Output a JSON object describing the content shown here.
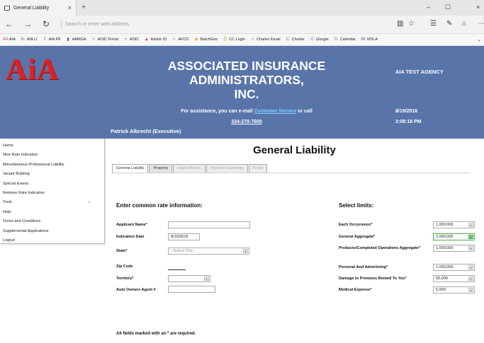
{
  "browser": {
    "tab_title": "General Liability",
    "tab_close": "×",
    "new_tab": "+",
    "address_placeholder": "Search or enter web address",
    "window_controls": [
      "–",
      "☐",
      "×"
    ],
    "favorites": [
      {
        "icon": "AA",
        "label": "AIA",
        "color": "#d63b2e"
      },
      {
        "icon": "in",
        "label": "AIA LI",
        "color": "#1c73b3"
      },
      {
        "icon": "f",
        "label": "AIA FB",
        "color": "#3b5998"
      },
      {
        "icon": "▮",
        "label": "AAMGA",
        "color": "#2e66b0"
      },
      {
        "icon": "☆",
        "label": "AOIC Portal",
        "color": "#444444"
      },
      {
        "icon": "☆",
        "label": "AOIC",
        "color": "#444444"
      },
      {
        "icon": "▲",
        "label": "Adobe ID",
        "color": "#e02020"
      },
      {
        "icon": "☆",
        "label": "AFCO",
        "color": "#444444"
      },
      {
        "icon": "◉",
        "label": "BatchGeo",
        "color": "#f0a020"
      },
      {
        "icon": "☰",
        "label": "CC Login",
        "color": "#d4a010"
      },
      {
        "icon": "☆",
        "label": "Charter Email",
        "color": "#444444"
      },
      {
        "icon": "C",
        "label": "Charter",
        "color": "#1f73c8"
      },
      {
        "icon": "G",
        "label": "Google",
        "color": "#4285f4"
      },
      {
        "icon": "G",
        "label": "Calendar",
        "color": "#34a853"
      },
      {
        "icon": "M",
        "label": "MSLA",
        "color": "#2b3d8f"
      }
    ]
  },
  "header": {
    "logo": "AiA",
    "company_line1": "ASSOCIATED INSURANCE ADMINISTRATORS,",
    "company_line2": "INC.",
    "assist_prefix": "For assistance, you can e-mail",
    "assist_link": "Customer Service",
    "assist_suffix": "or call",
    "phone": "334-279-7600",
    "agency": "AIA TEST AGENCY",
    "date": "8/19/2016",
    "time": "3:09:18 PM",
    "user": "Patrick Albrecht (Executive)"
  },
  "sidebar": {
    "items": [
      {
        "label": "Home"
      },
      {
        "label": "New Rate Indication"
      },
      {
        "label": "Miscellaneous Professional Liability"
      },
      {
        "label": "Vacant Building"
      },
      {
        "label": "Special Events"
      },
      {
        "label": "Retrieve Rate Indication"
      },
      {
        "label": "Tools",
        "arrow": "›"
      },
      {
        "label": "Help"
      },
      {
        "label": "Terms and Conditions"
      },
      {
        "label": "Supplemental Applications"
      },
      {
        "label": "Logout"
      }
    ]
  },
  "main": {
    "title": "General Liability",
    "tabs": [
      {
        "label": "General Liability",
        "state": "active"
      },
      {
        "label": "Property",
        "state": "normal"
      },
      {
        "label": "Inland Marine",
        "state": "disabled"
      },
      {
        "label": "Premium Summary",
        "state": "disabled"
      },
      {
        "label": "Finish",
        "state": "disabled"
      }
    ],
    "rate_section": "Enter common rate information:",
    "limits_section": "Select limits:",
    "fields": {
      "applicant_name": {
        "label": "Applicant Name*",
        "value": ""
      },
      "indication_date": {
        "label": "Indication Date",
        "value": "8/19/2016"
      },
      "state": {
        "label": "State*",
        "value": "--Select One--"
      },
      "zip": {
        "label": "Zip Code",
        "value": ""
      },
      "territory": {
        "label": "Territory*",
        "value": ""
      },
      "agent": {
        "label": "Auto Owners Agent #",
        "value": ""
      }
    },
    "limits": [
      {
        "label": "Each Occurrence*",
        "value": "1,000,000"
      },
      {
        "label": "General Aggregate*",
        "value": "2,000,000"
      },
      {
        "label": "Products/Completed Operations Aggregate*",
        "value": "1,000,000"
      },
      {
        "label": "Personal And Advertising*",
        "value": "1,000,000"
      },
      {
        "label": "Damage to Premises Rented To You*",
        "value": "50,000"
      },
      {
        "label": "Medical Expense*",
        "value": "5,000"
      }
    ],
    "footnote": "All fields marked with an * are required."
  },
  "colors": {
    "header_bg": "#5874a9",
    "logo_red": "#e02020",
    "link_blue": "#7fd3ff",
    "highlight_green": "#48b048"
  }
}
